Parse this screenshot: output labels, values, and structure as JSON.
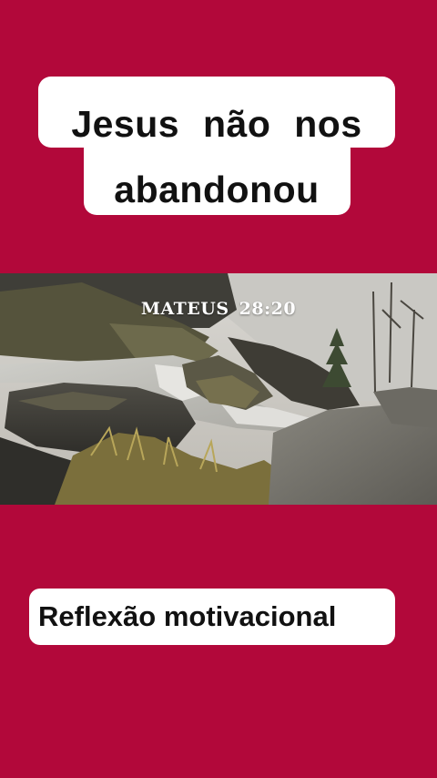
{
  "colors": {
    "background": "#b2083a",
    "caption_box": "#ffffff",
    "caption_text": "#111111"
  },
  "title": {
    "line1": "Jesus  não  nos",
    "line2": "abandonou"
  },
  "video": {
    "verse_reference": "MATEUS  28:20"
  },
  "subtitle": {
    "text": "Reflexão motivacional"
  }
}
